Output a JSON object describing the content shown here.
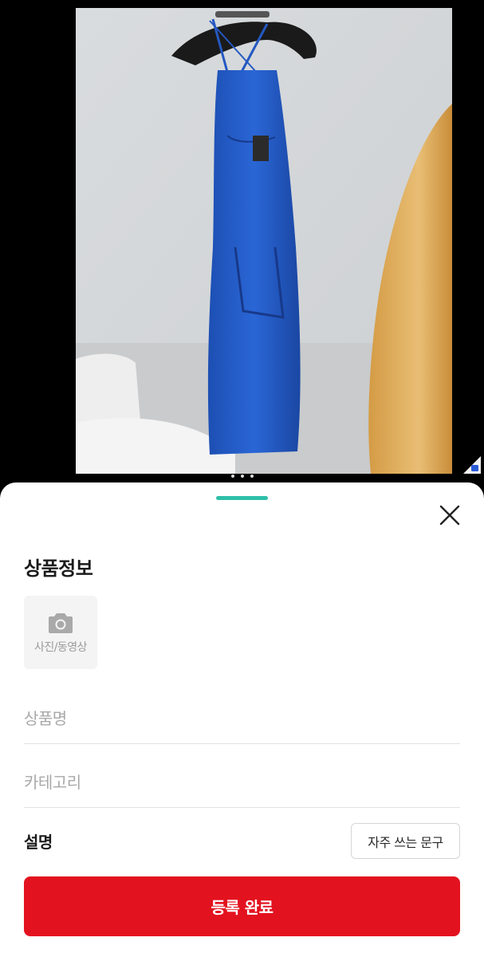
{
  "product_photo": {
    "icon": "product-photo",
    "pager_dots": 3,
    "badge_icon": "app-badge-icon"
  },
  "sheet": {
    "title": "상품정보",
    "close_icon": "close-icon",
    "accent_color": "#2fbfa9"
  },
  "media_picker": {
    "icon": "camera-icon",
    "label": "사진/동영상"
  },
  "form": {
    "name_placeholder": "상품명",
    "category_placeholder": "카테고리",
    "description_label": "설명",
    "phrases_button": "자주 쓰는 문구"
  },
  "submit": {
    "label": "등록 완료",
    "color": "#e3121f"
  }
}
